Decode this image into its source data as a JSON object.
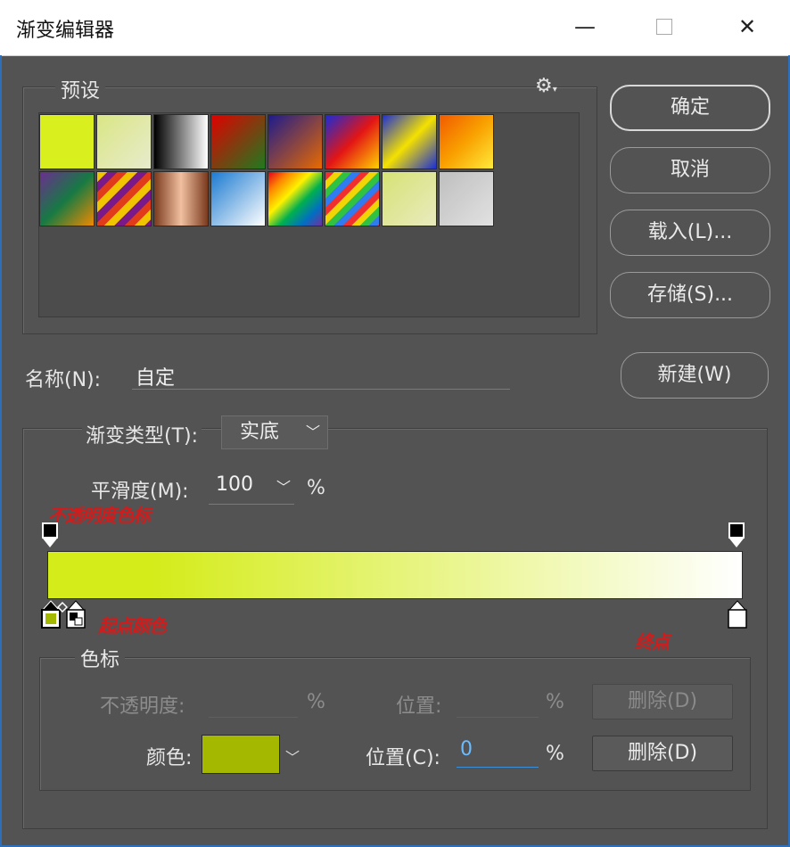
{
  "window": {
    "title": "渐变编辑器",
    "minimize": "—",
    "close": "✕"
  },
  "buttons": {
    "ok": "确定",
    "cancel": "取消",
    "load": "载入(L)...",
    "save": "存储(S)...",
    "new": "新建(W)"
  },
  "presets": {
    "legend": "预设",
    "gear_icon": "gear-icon",
    "row1": [
      {
        "css": "linear-gradient(#d9ef1e,#d9ef1e)"
      },
      {
        "css": "linear-gradient(135deg,#e6f48a,#f6f9d8)",
        "checker": true
      },
      {
        "css": "linear-gradient(90deg,#000,#fff)"
      },
      {
        "css": "linear-gradient(135deg,#e00000,#1f7a1f)"
      },
      {
        "css": "linear-gradient(135deg,#1d1b8c,#e86a00)"
      },
      {
        "css": "linear-gradient(135deg,#1a2bd6,#e31515,#ffd200)"
      },
      {
        "css": "linear-gradient(135deg,#1c2fd3,#f4e100,#1c2fd3)"
      },
      {
        "css": "linear-gradient(135deg,#f15a00,#f9a100,#ffea3b)"
      }
    ],
    "row2": [
      {
        "css": "linear-gradient(135deg,#6b2e8f,#167a43,#f08a00)"
      },
      {
        "css": "repeating-linear-gradient(135deg,#f0c400 0 8px,#7a1a8a 8px 16px,#e03c1a 16px 24px)"
      },
      {
        "css": "linear-gradient(90deg,#7a3a1e,#f1c0a0,#7a3a1e)"
      },
      {
        "css": "linear-gradient(135deg,#1b7ad1,#ffffff)"
      },
      {
        "css": "linear-gradient(135deg,#e0001b,#ff8a00,#fff200,#00b050,#0070c0,#7030a0)"
      },
      {
        "css": "repeating-linear-gradient(135deg,#ff2d2d 0 7px,#ffe100 7px 14px,#2ecc40 14px 21px,#2f7fff 21px 28px)",
        "checker": true
      },
      {
        "css": "linear-gradient(135deg,#e3ef7a,#f7f9c8)",
        "checker": true
      },
      {
        "css": "linear-gradient(135deg,#c9c9c9,#efefef)",
        "checker": true
      }
    ]
  },
  "name": {
    "label": "名称(N):",
    "value": "自定"
  },
  "gradient_type": {
    "label": "渐变类型(T):",
    "value": "实底"
  },
  "smoothness": {
    "label": "平滑度(M):",
    "value": "100",
    "unit": "%"
  },
  "gradient": {
    "start": "#d4ec1a",
    "end": "#ffffff"
  },
  "annotations": {
    "opacity_note": "不透明度色标",
    "start_note": "起点颜色",
    "end_note": "终点"
  },
  "stops": {
    "legend": "色标",
    "opacity_label": "不透明度:",
    "opacity_unit": "%",
    "opacity_pos_label": "位置:",
    "opacity_pos_unit": "%",
    "opacity_delete": "删除(D)",
    "color_label": "颜色:",
    "color_value": "#a4b800",
    "color_pos_label": "位置(C):",
    "color_pos_value": "0",
    "color_pos_unit": "%",
    "color_delete": "删除(D)"
  }
}
